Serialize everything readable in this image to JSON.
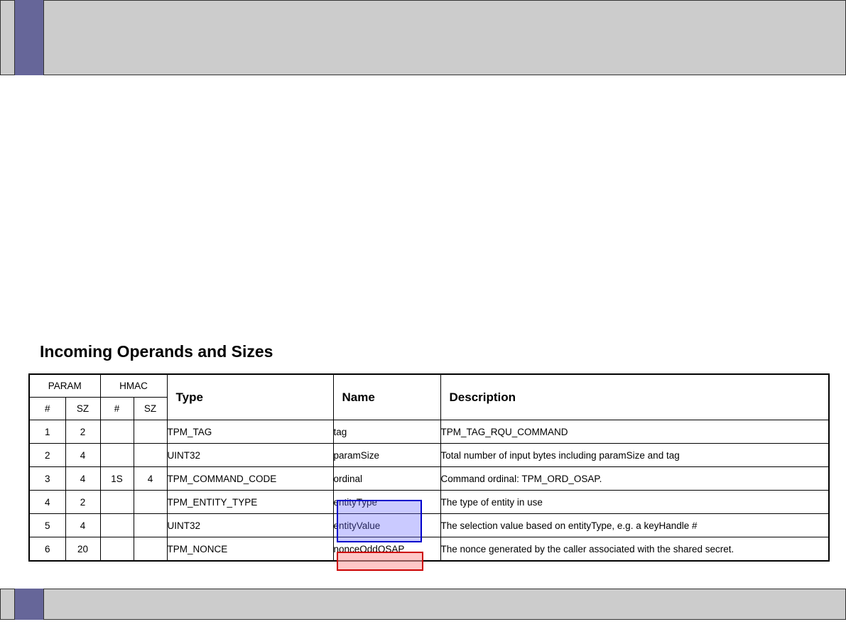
{
  "heading": "Incoming Operands and Sizes",
  "table": {
    "group_headers": {
      "param": "PARAM",
      "hmac": "HMAC"
    },
    "sub_headers": {
      "param_num": "#",
      "param_sz": "SZ",
      "hmac_num": "#",
      "hmac_sz": "SZ"
    },
    "columns": {
      "type": "Type",
      "name": "Name",
      "description": "Description"
    },
    "rows": [
      {
        "param_num": "1",
        "param_sz": "2",
        "hmac_num": "",
        "hmac_sz": "",
        "type": "TPM_TAG",
        "name": "tag",
        "description": "TPM_TAG_RQU_COMMAND"
      },
      {
        "param_num": "2",
        "param_sz": "4",
        "hmac_num": "",
        "hmac_sz": "",
        "type": "UINT32",
        "name": "paramSize",
        "description": "Total number of input bytes including paramSize and tag"
      },
      {
        "param_num": "3",
        "param_sz": "4",
        "hmac_num": "1S",
        "hmac_sz": "4",
        "type": "TPM_COMMAND_CODE",
        "name": "ordinal",
        "description": "Command ordinal: TPM_ORD_OSAP."
      },
      {
        "param_num": "4",
        "param_sz": "2",
        "hmac_num": "",
        "hmac_sz": "",
        "type": "TPM_ENTITY_TYPE",
        "name": "entityType",
        "description": "The type of entity in use"
      },
      {
        "param_num": "5",
        "param_sz": "4",
        "hmac_num": "",
        "hmac_sz": "",
        "type": "UINT32",
        "name": "entityValue",
        "description": "The selection value based on entityType, e.g. a keyHandle #"
      },
      {
        "param_num": "6",
        "param_sz": "20",
        "hmac_num": "",
        "hmac_sz": "",
        "type": "TPM_NONCE",
        "name": "nonceOddOSAP",
        "description": "The nonce generated by the caller associated with the shared secret."
      }
    ]
  },
  "highlights": {
    "blue": "#6666ff",
    "red": "#ff9999"
  },
  "colors": {
    "bar": "#cccccc",
    "accent": "#666699"
  }
}
